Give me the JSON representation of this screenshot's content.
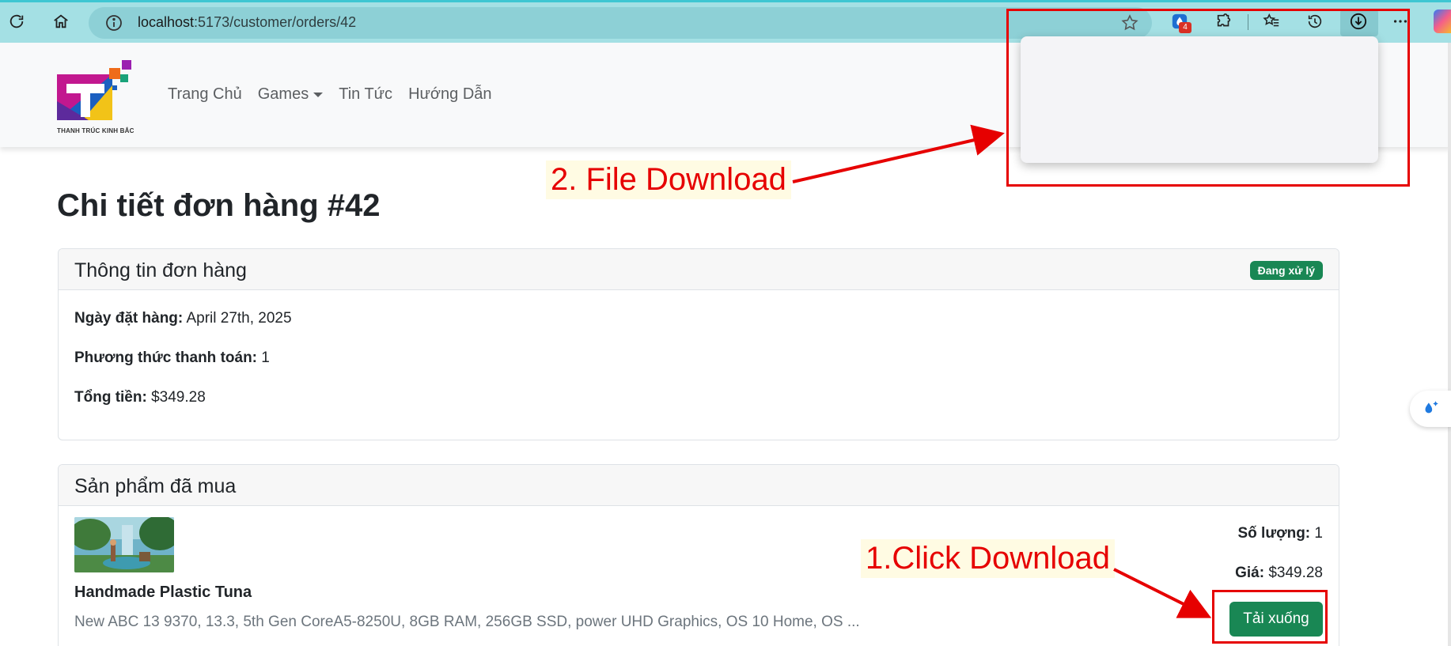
{
  "browser": {
    "url_host": "localhost",
    "url_path": ":5173/customer/orders/42",
    "extension_badge": "4",
    "icons": [
      "refresh-icon",
      "home-icon",
      "info-icon",
      "favorite-star-icon",
      "extension-icon",
      "puzzle-icon",
      "favorites-icon",
      "history-icon",
      "download-icon",
      "more-icon"
    ]
  },
  "navbar": {
    "brand_caption": "THANH TRÚC KINH BẮC",
    "links": [
      "Trang Chủ",
      "Games",
      "Tin Tức",
      "Hướng Dẫn"
    ]
  },
  "page": {
    "title": "Chi tiết đơn hàng #42"
  },
  "order_info": {
    "header": "Thông tin đơn hàng",
    "status": "Đang xử lý",
    "date_label": "Ngày đặt hàng:",
    "date_value": "April 27th, 2025",
    "payment_label": "Phương thức thanh toán:",
    "payment_value": "1",
    "total_label": "Tổng tiền:",
    "total_value": "$349.28"
  },
  "products": {
    "header": "Sản phẩm đã mua",
    "items": [
      {
        "name": "Handmade Plastic Tuna",
        "description": "New ABC 13 9370, 13.3, 5th Gen CoreA5-8250U, 8GB RAM, 256GB SSD, power UHD Graphics, OS 10 Home, OS ...",
        "qty_label": "Số lượng:",
        "qty_value": "1",
        "price_label": "Giá:",
        "price_value": "$349.28",
        "download_label": "Tải xuống"
      }
    ]
  },
  "annotations": {
    "step1": "1.Click Download",
    "step2": "2. File Download"
  },
  "colors": {
    "browser_bar": "#a4e0e4",
    "success": "#198754",
    "annotation": "#e60000"
  }
}
